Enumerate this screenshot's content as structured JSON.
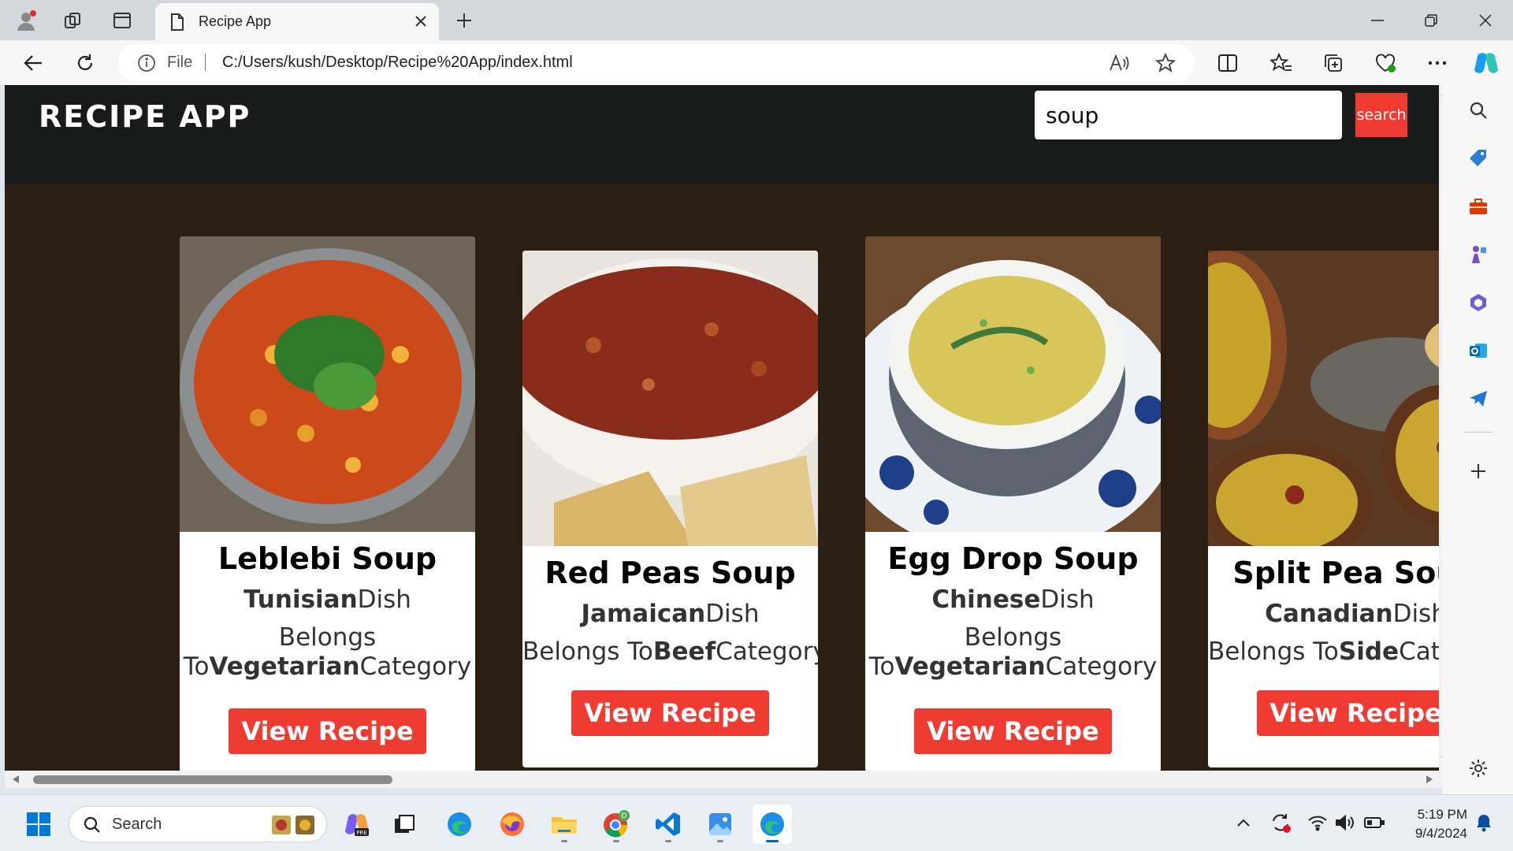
{
  "browser": {
    "tab_title": "Recipe App",
    "address_file_label": "File",
    "address_url": "C:/Users/kush/Desktop/Recipe%20App/index.html"
  },
  "app": {
    "title": "RECIPE APP",
    "search_value": "soup",
    "search_button": "search"
  },
  "recipes": [
    {
      "name": "Leblebi Soup",
      "area": "Tunisian",
      "area_suffix": "Dish",
      "cat_prefix": "Belongs To",
      "category": "Vegetarian",
      "cat_suffix": "Category",
      "button": "View Recipe"
    },
    {
      "name": "Red Peas Soup",
      "area": "Jamaican",
      "area_suffix": "Dish",
      "cat_prefix": "Belongs To",
      "category": "Beef",
      "cat_suffix": "Category",
      "button": "View Recipe"
    },
    {
      "name": "Egg Drop Soup",
      "area": "Chinese",
      "area_suffix": "Dish",
      "cat_prefix": "Belongs To",
      "category": "Vegetarian",
      "cat_suffix": "Category",
      "button": "View Recipe"
    },
    {
      "name": "Split Pea Soup",
      "area": "Canadian",
      "area_suffix": "Dish",
      "cat_prefix": "Belongs To",
      "category": "Side",
      "cat_suffix": "Category",
      "button": "View Recipe"
    }
  ],
  "taskbar": {
    "search_label": "Search",
    "time": "5:19 PM",
    "date": "9/4/2024"
  },
  "colors": {
    "accent_red": "#ef3b32",
    "page_bg": "#2b1f14",
    "header_bg": "#191a1a"
  }
}
